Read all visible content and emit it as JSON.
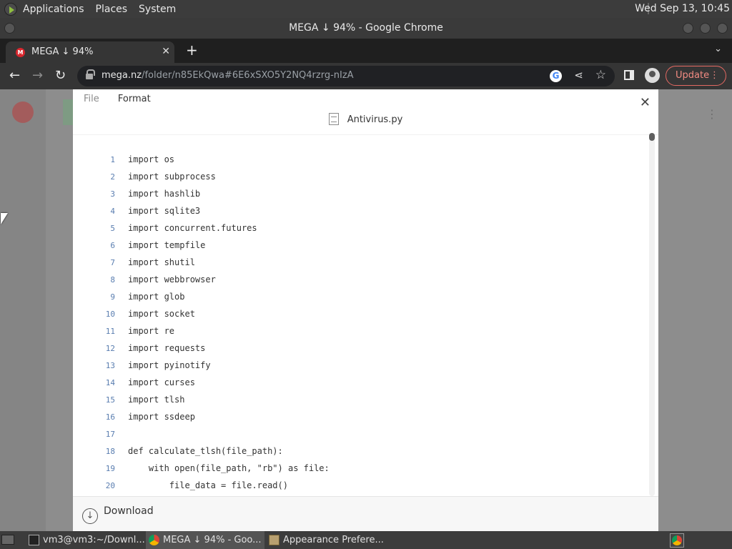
{
  "top_panel": {
    "menus": [
      "Applications",
      "Places",
      "System"
    ],
    "clock": "Wed Sep 13, 10:45"
  },
  "window": {
    "title": "MEGA ↓ 94% - Google Chrome"
  },
  "tabs": [
    {
      "title": "MEGA ↓ 94%",
      "favicon": "mega-icon"
    }
  ],
  "toolbar": {
    "url_host": "mega.nz",
    "url_path": "/folder/n85EkQwa#6E6xSXO5Y2NQ4rzrg-nIzA",
    "update_label": "Update"
  },
  "viewer": {
    "menu": {
      "file": "File",
      "format": "Format"
    },
    "filename": "Antivirus.py",
    "download_label": "Download",
    "lines": [
      {
        "n": "1",
        "code": "import os"
      },
      {
        "n": "2",
        "code": "import subprocess"
      },
      {
        "n": "3",
        "code": "import hashlib"
      },
      {
        "n": "4",
        "code": "import sqlite3"
      },
      {
        "n": "5",
        "code": "import concurrent.futures"
      },
      {
        "n": "6",
        "code": "import tempfile"
      },
      {
        "n": "7",
        "code": "import shutil"
      },
      {
        "n": "8",
        "code": "import webbrowser"
      },
      {
        "n": "9",
        "code": "import glob"
      },
      {
        "n": "10",
        "code": "import socket"
      },
      {
        "n": "11",
        "code": "import re"
      },
      {
        "n": "12",
        "code": "import requests"
      },
      {
        "n": "13",
        "code": "import pyinotify"
      },
      {
        "n": "14",
        "code": "import curses"
      },
      {
        "n": "15",
        "code": "import tlsh"
      },
      {
        "n": "16",
        "code": "import ssdeep"
      },
      {
        "n": "17",
        "code": ""
      },
      {
        "n": "18",
        "code": "def calculate_tlsh(file_path):"
      },
      {
        "n": "19",
        "code": "    with open(file_path, \"rb\") as file:"
      },
      {
        "n": "20",
        "code": "        file_data = file.read()"
      }
    ]
  },
  "taskbar": {
    "tasks": [
      {
        "label": "vm3@vm3:~/Downl...",
        "icon": "terminal-icon"
      },
      {
        "label": "MEGA ↓ 94% - Goo...",
        "icon": "chrome-icon"
      },
      {
        "label": "Appearance Prefere...",
        "icon": "preferences-icon"
      }
    ]
  },
  "colors": {
    "update_accent": "#f28b82",
    "line_number": "#5a7eb0",
    "mega_red": "#d9272e"
  }
}
